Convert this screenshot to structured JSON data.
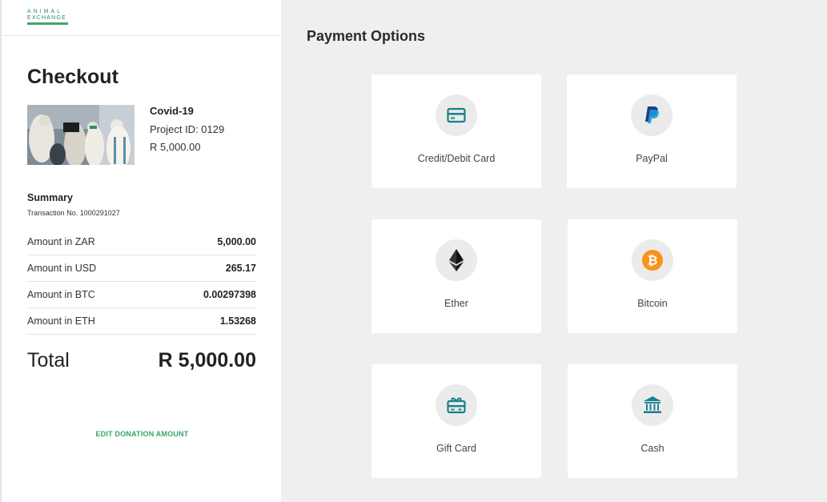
{
  "brand": {
    "line1": "ANIMAL",
    "line2": "EXCHANGE"
  },
  "checkout": {
    "title": "Checkout",
    "project_name": "Covid-19",
    "project_id": "Project ID: 0129",
    "project_amount": "R 5,000.00"
  },
  "summary": {
    "title": "Summary",
    "transaction": "Transaction No. 1000291027",
    "rows": [
      {
        "label": "Amount in ZAR",
        "value": "5,000.00"
      },
      {
        "label": "Amount in USD",
        "value": "265.17"
      },
      {
        "label": "Amount in BTC",
        "value": "0.00297398"
      },
      {
        "label": "Amount in ETH",
        "value": "1.53268"
      }
    ],
    "total_label": "Total",
    "total_value": "R 5,000.00",
    "edit_link": "EDIT DONATION AMOUNT"
  },
  "payment": {
    "title": "Payment Options",
    "options": [
      {
        "label": "Credit/Debit Card",
        "icon": "credit-card-icon"
      },
      {
        "label": "PayPal",
        "icon": "paypal-icon"
      },
      {
        "label": "Ether",
        "icon": "ethereum-icon"
      },
      {
        "label": "Bitcoin",
        "icon": "bitcoin-icon"
      },
      {
        "label": "Gift Card",
        "icon": "gift-card-icon"
      },
      {
        "label": "Cash",
        "icon": "bank-icon"
      }
    ]
  },
  "colors": {
    "accent": "#34a36a",
    "teal": "#1b7f8c",
    "bitcoin": "#f7931a",
    "paypal_dark": "#253b80",
    "paypal_light": "#179bd7"
  }
}
